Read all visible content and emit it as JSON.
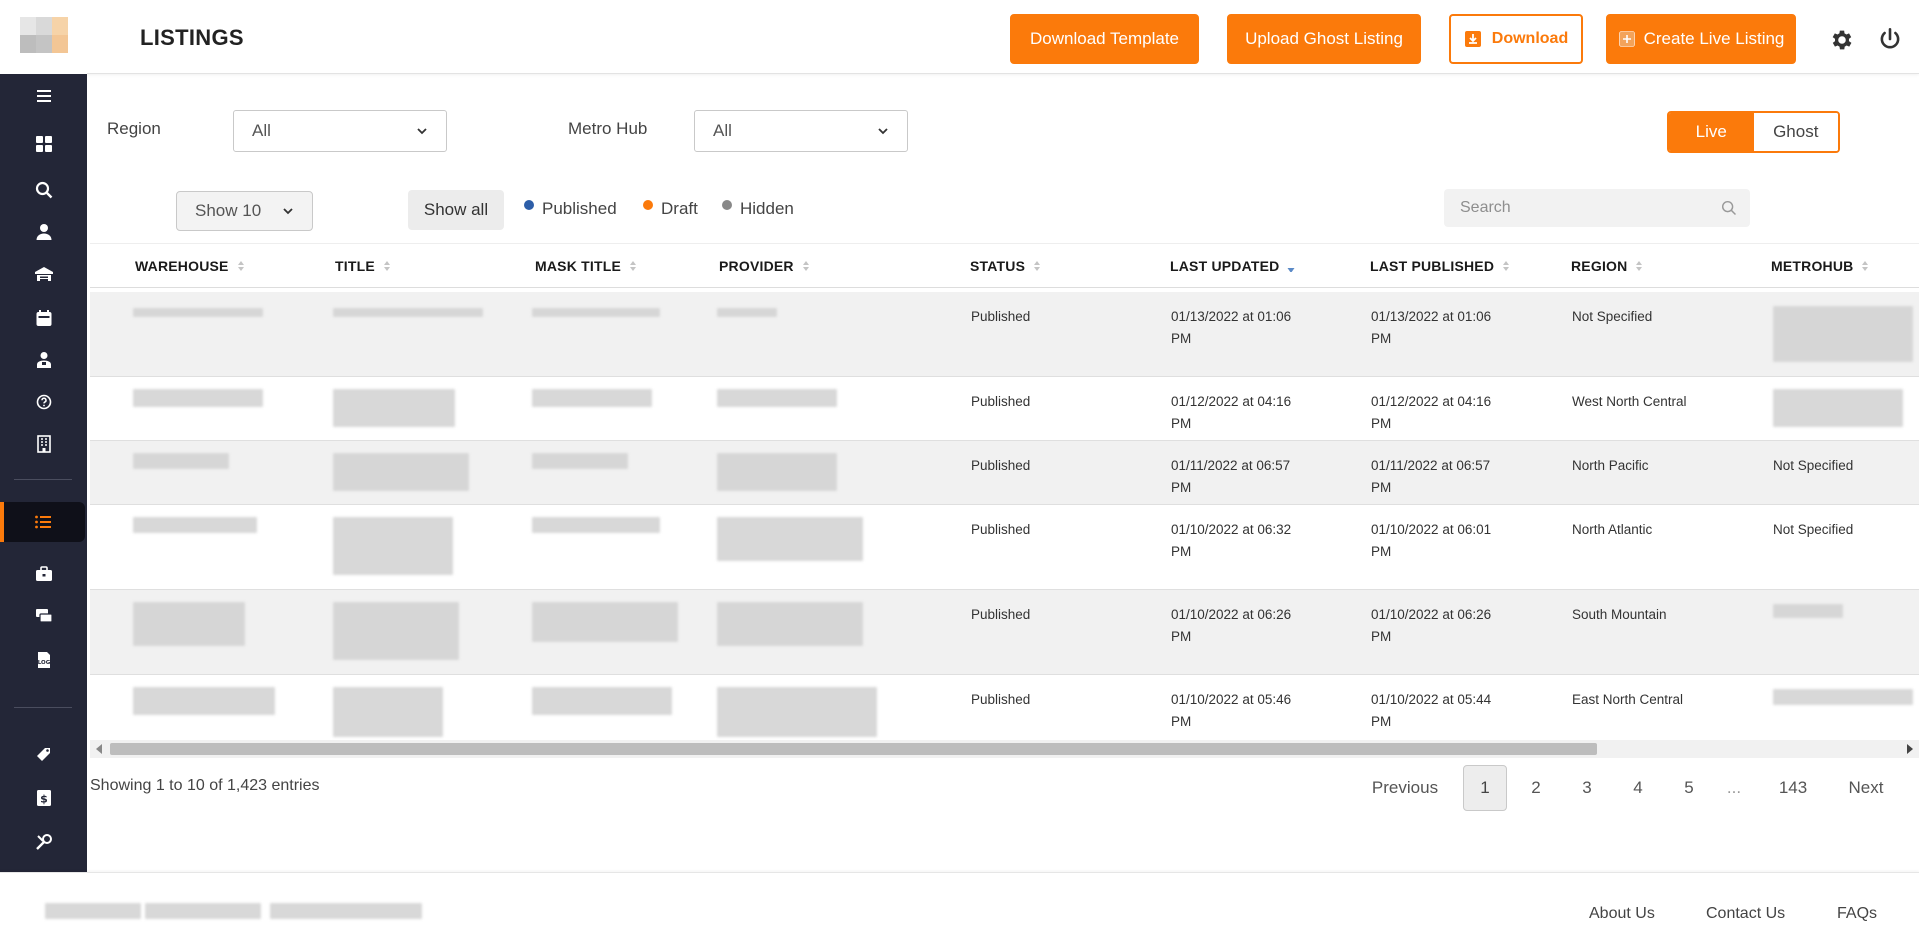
{
  "header": {
    "title": "LISTINGS",
    "buttons": {
      "download_template": "Download Template",
      "upload_ghost": "Upload Ghost Listing",
      "download": "Download",
      "create_live": "Create Live Listing"
    }
  },
  "filters": {
    "region_label": "Region",
    "region_value": "All",
    "metro_label": "Metro Hub",
    "metro_value": "All",
    "toggle": {
      "live": "Live",
      "ghost": "Ghost",
      "selected": "Live"
    }
  },
  "toolbar": {
    "show_value": "Show 10",
    "show_all": "Show all",
    "legend": [
      {
        "label": "Published",
        "color": "#2d5ea8"
      },
      {
        "label": "Draft",
        "color": "#fb7a0b"
      },
      {
        "label": "Hidden",
        "color": "#888888"
      }
    ],
    "search_placeholder": "Search"
  },
  "table": {
    "columns": [
      "WAREHOUSE",
      "TITLE",
      "MASK TITLE",
      "PROVIDER",
      "STATUS",
      "LAST UPDATED",
      "LAST PUBLISHED",
      "REGION",
      "METROHUB"
    ],
    "sorted_column": "LAST UPDATED",
    "rows": [
      {
        "status": "Published",
        "updated": [
          "01/13/2022 at 01:06",
          "PM"
        ],
        "published": [
          "01/13/2022 at 01:06",
          "PM"
        ],
        "region": "Not Specified",
        "metrohub": ""
      },
      {
        "status": "Published",
        "updated": [
          "01/12/2022 at 04:16",
          "PM"
        ],
        "published": [
          "01/12/2022 at 04:16",
          "PM"
        ],
        "region": "West North Central",
        "metrohub": ""
      },
      {
        "status": "Published",
        "updated": [
          "01/11/2022 at 06:57",
          "PM"
        ],
        "published": [
          "01/11/2022 at 06:57",
          "PM"
        ],
        "region": "North Pacific",
        "metrohub": "Not Specified"
      },
      {
        "status": "Published",
        "updated": [
          "01/10/2022 at 06:32",
          "PM"
        ],
        "published": [
          "01/10/2022 at 06:01",
          "PM"
        ],
        "region": "North Atlantic",
        "metrohub": "Not Specified"
      },
      {
        "status": "Published",
        "updated": [
          "01/10/2022 at 06:26",
          "PM"
        ],
        "published": [
          "01/10/2022 at 06:26",
          "PM"
        ],
        "region": "South Mountain",
        "metrohub": ""
      },
      {
        "status": "Published",
        "updated": [
          "01/10/2022 at 05:46",
          "PM"
        ],
        "published": [
          "01/10/2022 at 05:44",
          "PM"
        ],
        "region": "East North Central",
        "metrohub": ""
      }
    ]
  },
  "pagination": {
    "info": "Showing 1 to 10 of 1,423 entries",
    "previous": "Previous",
    "pages": [
      "1",
      "2",
      "3",
      "4",
      "5",
      "...",
      "143"
    ],
    "current": "1",
    "next": "Next"
  },
  "footer": {
    "links": [
      "About Us",
      "Contact Us",
      "FAQs"
    ]
  },
  "colors": {
    "accent": "#fb7a0b",
    "sidebar": "#232637"
  },
  "sidebar_icons": [
    "menu-icon",
    "dashboard-icon",
    "search-icon",
    "user-icon",
    "warehouse-icon",
    "calendar-icon",
    "user-badge-icon",
    "help-icon",
    "building-icon",
    "listings-icon",
    "briefcase-icon",
    "chat-icon",
    "log-icon",
    "tag-icon",
    "dollar-icon",
    "tools-icon"
  ]
}
